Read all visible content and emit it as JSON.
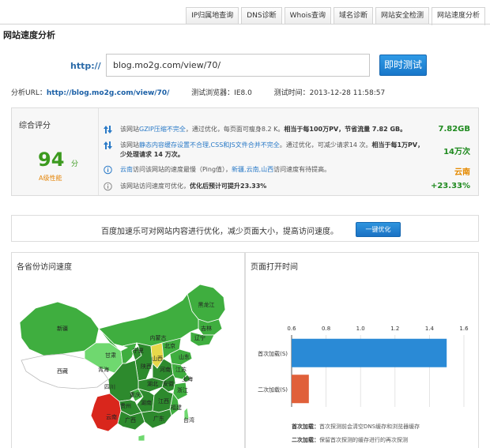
{
  "tabs": [
    {
      "label": "IP归属地查询"
    },
    {
      "label": "DNS诊断"
    },
    {
      "label": "Whois查询"
    },
    {
      "label": "域名诊断"
    },
    {
      "label": "网站安全检测"
    },
    {
      "label": "网站速度分析"
    }
  ],
  "page_title": "网站速度分析",
  "url_form": {
    "prefix": "http://",
    "value": "blog.mo2g.com/view/70/",
    "button": "即时测试"
  },
  "info": {
    "url_label": "分析URL：",
    "url_value": "http://blog.mo2g.com/view/70/",
    "browser_label": "测试浏览器：",
    "browser_value": "IE8.0",
    "time_label": "测试时间：",
    "time_value": "2013-12-28 11:58:57"
  },
  "summary": {
    "title": "综合评分",
    "score": "94",
    "score_unit": "分",
    "grade": "A级性能",
    "items": [
      {
        "icon": "arrow-up-down-icon",
        "text_before": "该网站",
        "highlight": "GZIP压缩不完全",
        "text_after": "，通过优化，每页面可瘦身8.2 K。",
        "bold": "相当于每100万PV，节省流量 7.82 GB。",
        "value": "7.82GB",
        "value_color": "green"
      },
      {
        "icon": "arrow-up-down-icon",
        "text_before": "该网站",
        "highlight": "静态内容缓存设置不合理,CSS和JS文件合并不完全",
        "text_after": "。通过优化，可减少请求14 次。",
        "bold": "相当于每1万PV，少处理请求 14 万次。",
        "value": "14万次",
        "value_color": "green"
      },
      {
        "icon": "info-icon",
        "text_before": "",
        "highlight": "云南",
        "text_after": "访问该网站的速度最慢（Ping值），",
        "highlight2": "新疆,云南,山西",
        "text_after2": "访问速度有待提高。",
        "value": "云南",
        "value_color": "orange"
      },
      {
        "icon": "info-icon",
        "text_before": "该网站访问速度可优化，",
        "bold": "优化后预计可提升23.33%",
        "value": "+23.33%",
        "value_color": "green"
      }
    ]
  },
  "optimize": {
    "text": "百度加速乐可对网站内容进行优化，减少页面大小，提高访问速度。",
    "button": "一键优化"
  },
  "map_panel": {
    "title": "各省份访问速度",
    "labels": [
      "黑龙江",
      "吉林",
      "辽宁",
      "内蒙古",
      "北京",
      "新疆",
      "甘肃",
      "宁夏",
      "青海",
      "西藏",
      "山西",
      "山东",
      "陕西",
      "河南",
      "江苏",
      "四川",
      "湖北",
      "安徽",
      "上海",
      "重庆",
      "浙江",
      "贵州",
      "湖南",
      "江西",
      "福建",
      "云南",
      "广西",
      "广东",
      "台湾"
    ],
    "colors": {
      "fast": "#2d8a2d",
      "good": "#3fae3f",
      "medium": "#6fd86f",
      "slow_yellow": "#e8d84a",
      "slowest_red": "#d9261c"
    }
  },
  "time_panel": {
    "title": "页面打开时间",
    "legend": [
      {
        "label": "首次加载：",
        "text": "首次探测前会清空DNS缓存和浏览器缓存"
      },
      {
        "label": "二次加载：",
        "text": "保留首次探测的缓存进行的再次探测"
      }
    ]
  },
  "chart_data": {
    "type": "bar",
    "orientation": "horizontal",
    "categories": [
      "首次加载(S)",
      "二次加载(S)"
    ],
    "values": [
      1.5,
      0.7
    ],
    "colors": [
      "#2a8ad6",
      "#e0603a"
    ],
    "xlim": [
      0.6,
      1.6
    ],
    "xticks": [
      "0.6",
      "0.8",
      "1.0",
      "1.2",
      "1.4",
      "1.6"
    ],
    "grid": true
  }
}
